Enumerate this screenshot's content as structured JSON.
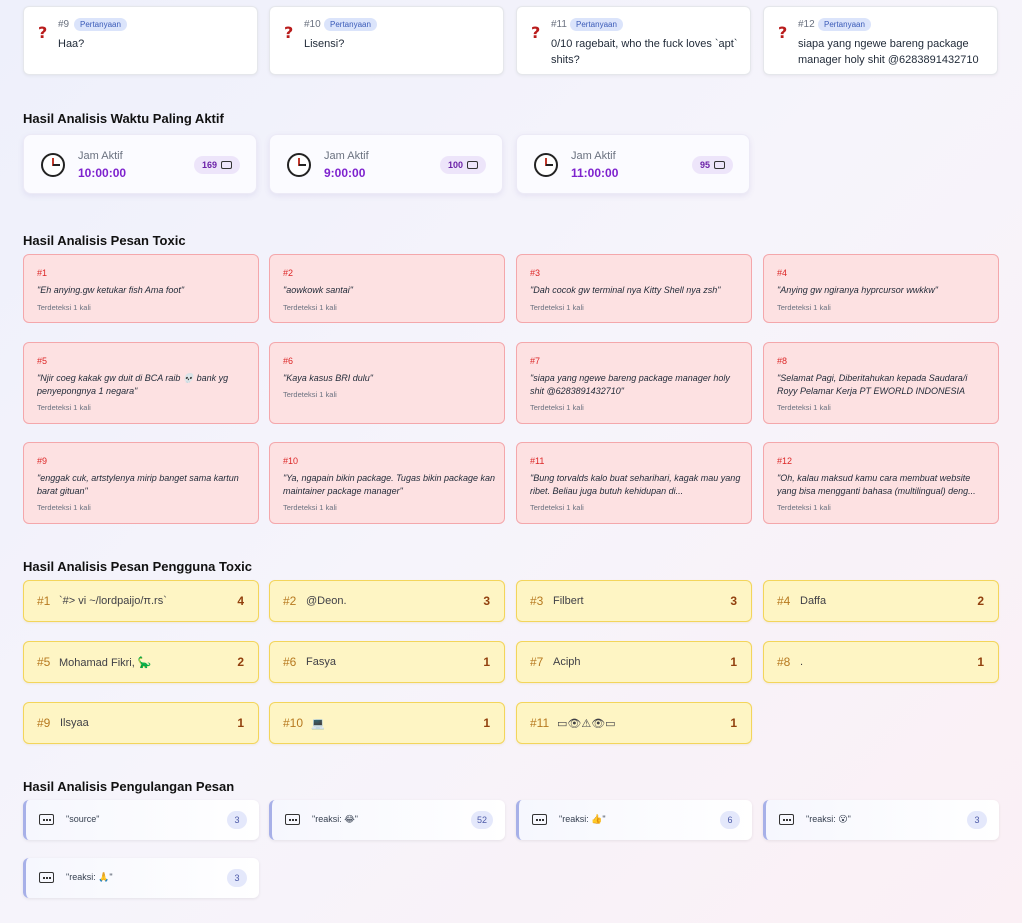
{
  "questions": [
    {
      "num": "#9",
      "badge": "Pertanyaan",
      "icon": "question-mark-icon",
      "text": "Haa?"
    },
    {
      "num": "#10",
      "badge": "Pertanyaan",
      "icon": "question-mark-icon",
      "text": "Lisensi?"
    },
    {
      "num": "#11",
      "badge": "Pertanyaan",
      "icon": "question-mark-icon",
      "text": "0/10 ragebait, who the fuck loves `apt` shits?"
    },
    {
      "num": "#12",
      "badge": "Pertanyaan",
      "icon": "question-mark-icon",
      "text": "siapa yang ngewe bareng package manager holy shit @6283891432710"
    }
  ],
  "active_time": {
    "title": "Hasil Analisis Waktu Paling Aktif",
    "items": [
      {
        "label": "Jam Aktif",
        "time": "10:00:00",
        "count": "169"
      },
      {
        "label": "Jam Aktif",
        "time": "9:00:00",
        "count": "100"
      },
      {
        "label": "Jam Aktif",
        "time": "11:00:00",
        "count": "95"
      }
    ]
  },
  "toxic_messages": {
    "title": "Hasil Analisis Pesan Toxic",
    "items": [
      {
        "num": "#1",
        "text": "\"Eh anying.gw ketukar fish Ama foot\"",
        "detected": "Terdeteksi 1 kali"
      },
      {
        "num": "#2",
        "text": "\"aowkowk santai\"",
        "detected": "Terdeteksi 1 kali"
      },
      {
        "num": "#3",
        "text": "\"Dah cocok gw terminal nya Kitty Shell nya zsh\"",
        "detected": "Terdeteksi 1 kali"
      },
      {
        "num": "#4",
        "text": "\"Anying gw ngiranya hyprcursor wwkkw\"",
        "detected": "Terdeteksi 1 kali"
      },
      {
        "num": "#5",
        "text": "\"Njir coeg kakak gw duit di BCA raib 💀 bank yg penyepongnya 1 negara\"",
        "detected": "Terdeteksi 1 kali"
      },
      {
        "num": "#6",
        "text": "\"Kaya kasus BRI dulu\"",
        "detected": "Terdeteksi 1 kali"
      },
      {
        "num": "#7",
        "text": "\"siapa yang ngewe bareng package manager holy shit @6283891432710\"",
        "detected": "Terdeteksi 1 kali"
      },
      {
        "num": "#8",
        "text": "\"Selamat Pagi, Diberitahukan kepada Saudara/i Royy Pelamar Kerja PT EWORLD INDONESIA yan...",
        "detected": "Terdeteksi 1 kali"
      },
      {
        "num": "#9",
        "text": "\"enggak cuk, artstylenya mirip banget sama kartun barat gituan\"",
        "detected": "Terdeteksi 1 kali"
      },
      {
        "num": "#10",
        "text": "\"Ya, ngapain bikin package. Tugas bikin package kan maintainer package manager\"",
        "detected": "Terdeteksi 1 kali"
      },
      {
        "num": "#11",
        "text": "\"Bung torvalds kalo buat seharihari, kagak mau yang ribet. Beliau juga butuh kehidupan di...",
        "detected": "Terdeteksi 1 kali"
      },
      {
        "num": "#12",
        "text": "\"Oh, kalau maksud kamu cara membuat website yang bisa mengganti bahasa (multilingual) deng...",
        "detected": "Terdeteksi 1 kali"
      }
    ]
  },
  "toxic_users": {
    "title": "Hasil Analisis Pesan Pengguna Toxic",
    "items": [
      {
        "rank": "#1",
        "name": "`#> vi ~/lordpaijo/π.rs`",
        "count": "4"
      },
      {
        "rank": "#2",
        "name": "@Deon.",
        "count": "3"
      },
      {
        "rank": "#3",
        "name": "Filbert",
        "count": "3"
      },
      {
        "rank": "#4",
        "name": "Daffa",
        "count": "2"
      },
      {
        "rank": "#5",
        "name": "Mohamad Fikri, 🦕",
        "count": "2"
      },
      {
        "rank": "#6",
        "name": "Fasya",
        "count": "1"
      },
      {
        "rank": "#7",
        "name": "Aciph",
        "count": "1"
      },
      {
        "rank": "#8",
        "name": ".",
        "count": "1"
      },
      {
        "rank": "#9",
        "name": "Ilsyaa",
        "count": "1"
      },
      {
        "rank": "#10",
        "name": "💻",
        "count": "1"
      },
      {
        "rank": "#11",
        "name": "▭👁⚠👁▭",
        "count": "1"
      }
    ]
  },
  "repeated_messages": {
    "title": "Hasil Analisis Pengulangan Pesan",
    "items": [
      {
        "text": "\"source\"",
        "count": "3"
      },
      {
        "text": "\"reaksi: 😂\"",
        "count": "52"
      },
      {
        "text": "\"reaksi: 👍\"",
        "count": "6"
      },
      {
        "text": "\"reaksi: 😮\"",
        "count": "3"
      },
      {
        "text": "\"reaksi: 🙏\"",
        "count": "3"
      }
    ]
  }
}
